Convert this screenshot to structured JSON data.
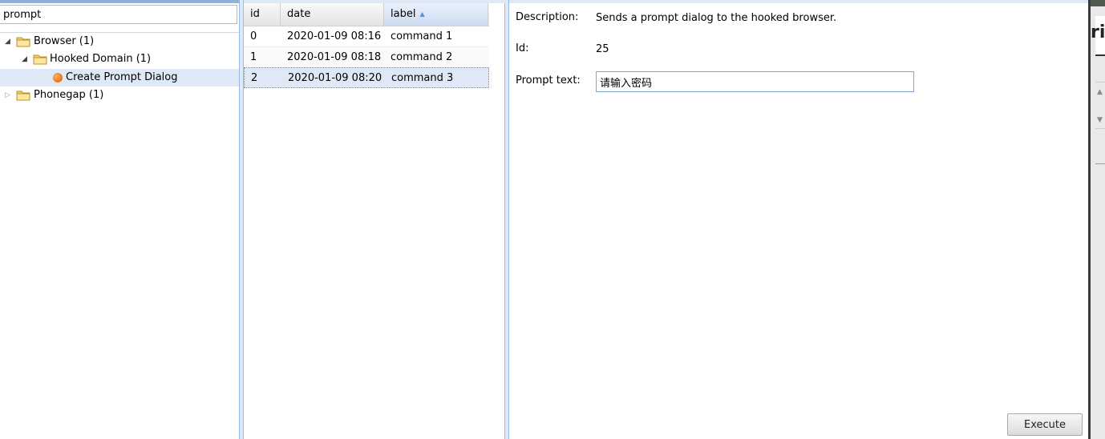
{
  "tree": {
    "search_value": "prompt",
    "nodes": [
      {
        "label": "Browser (1)",
        "expanded": true
      },
      {
        "label": "Hooked Domain (1)",
        "expanded": true
      },
      {
        "label": "Create Prompt Dialog",
        "selected": true
      },
      {
        "label": "Phonegap (1)",
        "expanded": false
      }
    ]
  },
  "grid": {
    "columns": [
      "id",
      "date",
      "label"
    ],
    "sorted_column": "label",
    "sort_direction": "ascending",
    "rows": [
      {
        "id": "0",
        "date": "2020-01-09 08:16",
        "label": "command 1"
      },
      {
        "id": "1",
        "date": "2020-01-09 08:18",
        "label": "command 2"
      },
      {
        "id": "2",
        "date": "2020-01-09 08:20",
        "label": "command 3",
        "selected": true
      }
    ]
  },
  "detail": {
    "description_label": "Description:",
    "description_value": "Sends a prompt dialog to the hooked browser.",
    "id_label": "Id:",
    "id_value": "25",
    "prompt_label": "Prompt text:",
    "prompt_value": "请输入密码",
    "execute_label": "Execute"
  },
  "right_edge": {
    "partial_text": "ri"
  },
  "colors": {
    "panel_border": "#99bbe8",
    "selection": "#dfe8f6",
    "leaf_icon": "#f07a1e",
    "folder": "#f5d36a"
  },
  "icons": [
    "expand-arrow-icon",
    "collapse-arrow-icon",
    "folder-icon",
    "command-status-icon",
    "sort-ascending-icon",
    "scroll-up-icon",
    "scroll-down-icon"
  ]
}
